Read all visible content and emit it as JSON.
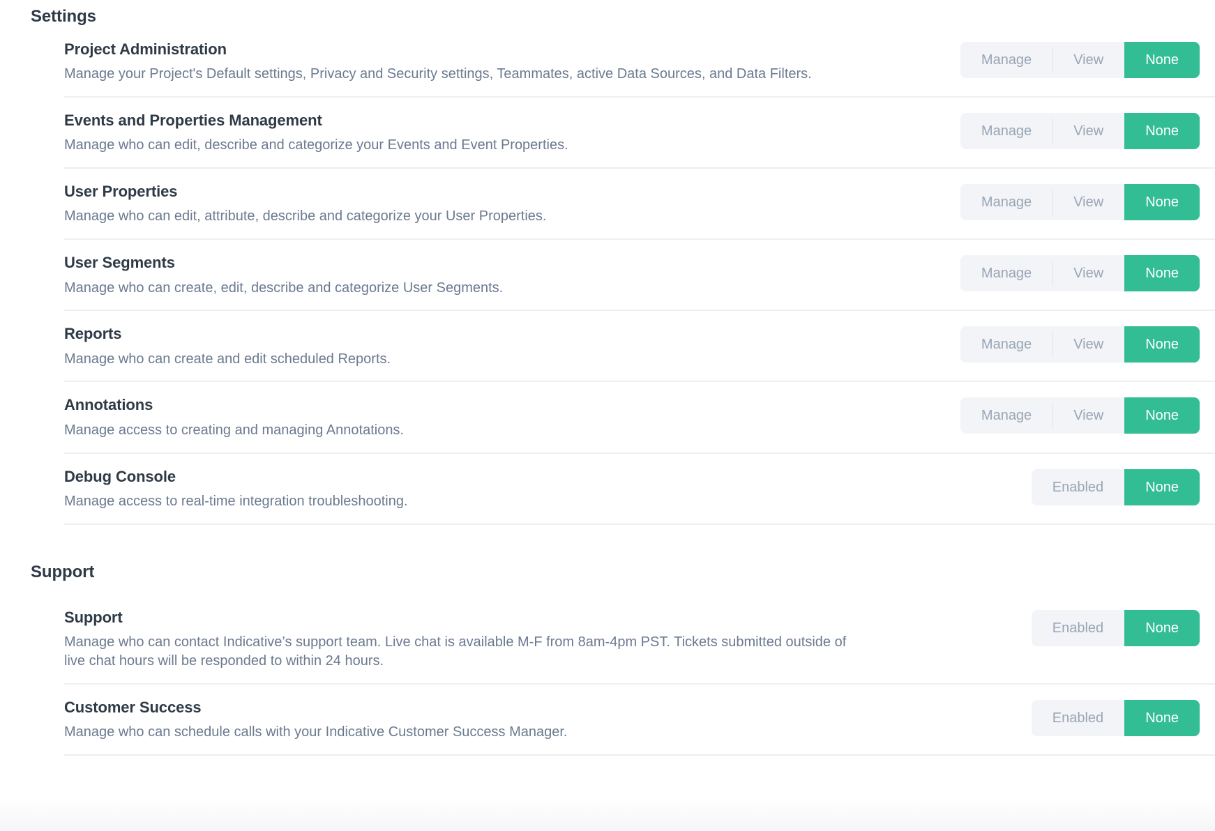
{
  "sections": [
    {
      "id": "settings",
      "heading": "Settings",
      "rows": [
        {
          "title": "Project Administration",
          "description": "Manage your Project's Default settings, Privacy and Security settings, Teammates, active Data Sources, and Data Filters.",
          "options": [
            "Manage",
            "View",
            "None"
          ],
          "selected": "None"
        },
        {
          "title": "Events and Properties Management",
          "description": "Manage who can edit, describe and categorize your Events and Event Properties.",
          "options": [
            "Manage",
            "View",
            "None"
          ],
          "selected": "None"
        },
        {
          "title": "User Properties",
          "description": "Manage who can edit, attribute, describe and categorize your User Properties.",
          "options": [
            "Manage",
            "View",
            "None"
          ],
          "selected": "None"
        },
        {
          "title": "User Segments",
          "description": "Manage who can create, edit, describe and categorize User Segments.",
          "options": [
            "Manage",
            "View",
            "None"
          ],
          "selected": "None"
        },
        {
          "title": "Reports",
          "description": "Manage who can create and edit scheduled Reports.",
          "options": [
            "Manage",
            "View",
            "None"
          ],
          "selected": "None"
        },
        {
          "title": "Annotations",
          "description": "Manage access to creating and managing Annotations.",
          "options": [
            "Manage",
            "View",
            "None"
          ],
          "selected": "None"
        },
        {
          "title": "Debug Console",
          "description": "Manage access to real-time integration troubleshooting.",
          "options": [
            "Enabled",
            "None"
          ],
          "selected": "None"
        }
      ]
    },
    {
      "id": "support",
      "heading": "Support",
      "rows": [
        {
          "title": "Support",
          "description": "Manage who can contact Indicative’s support team. Live chat is available M-F from 8am-4pm PST. Tickets submitted outside of live chat hours will be responded to within 24 hours.",
          "options": [
            "Enabled",
            "None"
          ],
          "selected": "None"
        },
        {
          "title": "Customer Success",
          "description": "Manage who can schedule calls with your Indicative Customer Success Manager.",
          "options": [
            "Enabled",
            "None"
          ],
          "selected": "None"
        }
      ]
    }
  ],
  "colors": {
    "accent_green": "#32bd94",
    "segment_bg": "#f2f4f7",
    "segment_text": "#9aa5b5",
    "title_text": "#2e3a46",
    "desc_text": "#6b7a90",
    "divider": "#eceff3"
  }
}
